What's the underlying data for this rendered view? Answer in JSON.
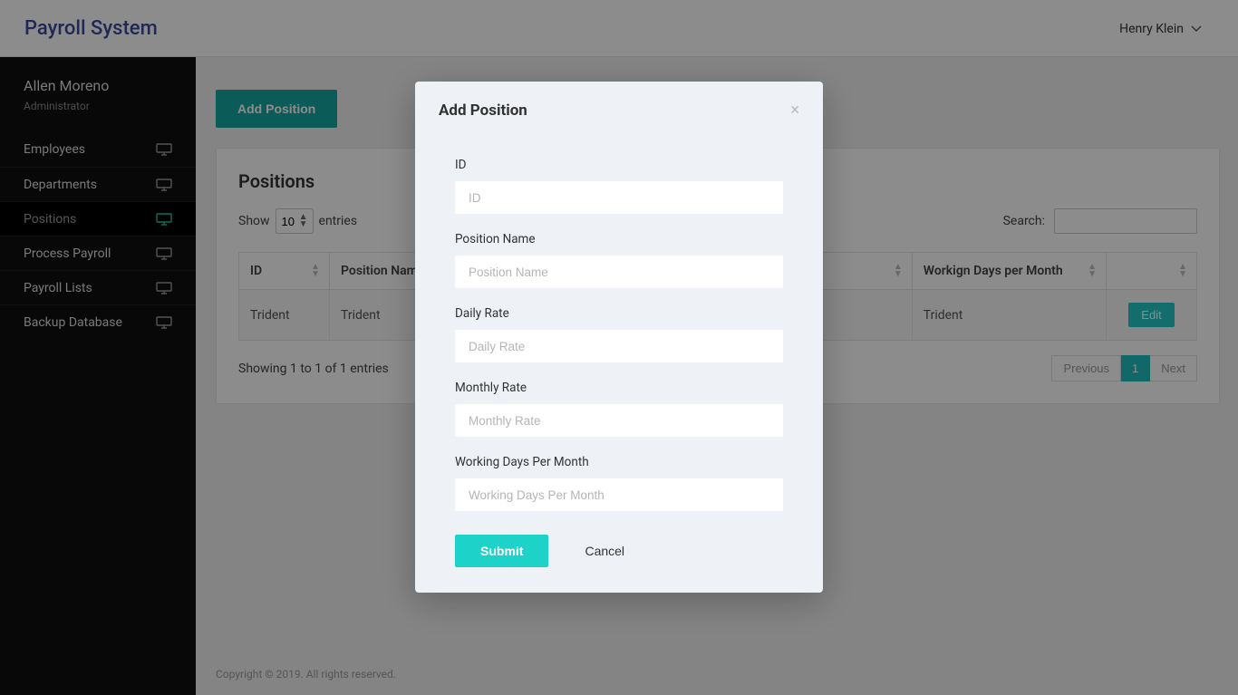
{
  "topbar": {
    "brand": "Payroll System",
    "username": "Henry Klein"
  },
  "sidebar": {
    "user": {
      "name": "Allen Moreno",
      "role": "Administrator"
    },
    "items": [
      {
        "label": "Employees",
        "active": false
      },
      {
        "label": "Departments",
        "active": false
      },
      {
        "label": "Positions",
        "active": true
      },
      {
        "label": "Process Payroll",
        "active": false
      },
      {
        "label": "Payroll Lists",
        "active": false
      },
      {
        "label": "Backup Database",
        "active": false
      }
    ]
  },
  "main": {
    "add_button": "Add Position",
    "panel_title": "Positions",
    "controls": {
      "show_label": "Show",
      "entries_label": "entries",
      "page_size": "10",
      "search_label": "Search:",
      "search_value": ""
    },
    "columns": {
      "id": "ID",
      "position_name": "Position Name",
      "working_days": "Workign Days per Month",
      "actions": ""
    },
    "rows": [
      {
        "id": "Trident",
        "position_name": "Trident",
        "working_days": "Trident",
        "edit": "Edit"
      }
    ],
    "info": "Showing 1 to 1 of 1 entries",
    "pager": {
      "prev": "Previous",
      "current": "1",
      "next": "Next"
    }
  },
  "copyright": "Copyright © 2019. All rights reserved.",
  "modal": {
    "title": "Add Position",
    "fields": {
      "id": {
        "label": "ID",
        "placeholder": "ID"
      },
      "position_name": {
        "label": "Position Name",
        "placeholder": "Position Name"
      },
      "daily_rate": {
        "label": "Daily Rate",
        "placeholder": "Daily Rate"
      },
      "monthly_rate": {
        "label": "Monthly Rate",
        "placeholder": "Monthly Rate"
      },
      "working_days": {
        "label": "Working Days Per Month",
        "placeholder": "Working Days Per Month"
      }
    },
    "submit": "Submit",
    "cancel": "Cancel"
  }
}
